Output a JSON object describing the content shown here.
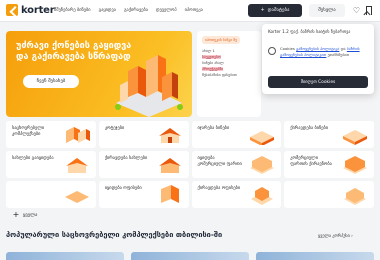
{
  "header": {
    "logo_text": "korter",
    "nav": [
      "მშენებარე ბინები",
      "გაყიდვა",
      "გაქირავება",
      "დეველოპ",
      "იპოთეკა"
    ],
    "add_button": "დამატება",
    "login_button": "შესვლა"
  },
  "hero": {
    "title": "უძრავი ქონების გაყიდვა და გაქირავება სწრაფად",
    "button": "ჩვენ შესახებ"
  },
  "promo": {
    "tag": "იპოთეკის ბანკი მე",
    "line1": "ახალ 1",
    "highlight1": "საუკეთესო",
    "line2": "ბინები ახალ",
    "highlight2": "პროექტებში",
    "line3": "შესაბამისი ფასებით",
    "link": "დეტალურად"
  },
  "cookie": {
    "header": "Korter 1.2 ფაქ. ბაზრის საიტის ნებართვა",
    "text_before": "Cookies",
    "link1": "გამოყენების პოლიტიკა",
    "text_mid": "და",
    "link2": "ბაზრის გამოყენების პოლიტიკით",
    "text_after": "ეთანხმებით",
    "button": "მიიღეთ Cookies"
  },
  "categories": [
    {
      "label": "საცხოვრებელი კომპლექსები"
    },
    {
      "label": "კოტეჯები"
    },
    {
      "label": "იჯარება ბინები"
    },
    {
      "label": "ქირავდება ბინები"
    },
    {
      "label": "სახლები გაიყიდება"
    },
    {
      "label": "ქირავდება სახლები"
    },
    {
      "label": "იყიდება კომერციული ფართი"
    },
    {
      "label": "კომერციული ფართის ქირავნობა"
    },
    {
      "label": ""
    },
    {
      "label": "იყიდება ოფისები"
    },
    {
      "label": "ქირავდება ოფისები"
    },
    {
      "label": ""
    }
  ],
  "more_label": "ყველა",
  "section": {
    "title": "პოპულარული საცხოვრებელი კომპლექსები თბილისი-ში",
    "see_all": "ყველა კორპუსი"
  },
  "colors": {
    "accent": "#f59e0b",
    "dark": "#262b36"
  }
}
